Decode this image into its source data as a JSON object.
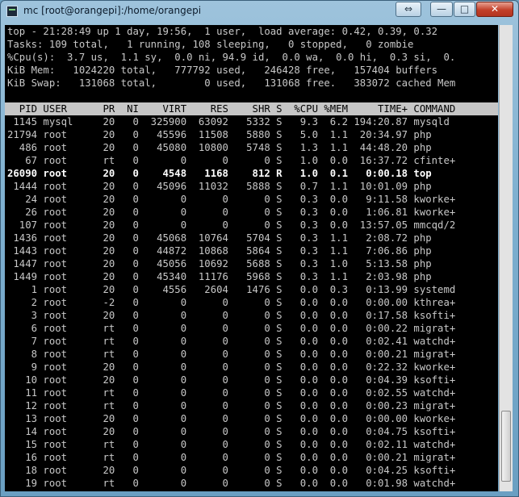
{
  "window": {
    "title": "mc [root@orangepi]:/home/orangepi",
    "buttons": {
      "resize": "⇔",
      "minimize": "—",
      "maximize": "□",
      "close": "✕"
    }
  },
  "summary": [
    "top - 21:28:49 up 1 day, 19:56,  1 user,  load average: 0.42, 0.39, 0.32",
    "Tasks: 109 total,   1 running, 108 sleeping,   0 stopped,   0 zombie",
    "%Cpu(s):  3.7 us,  1.1 sy,  0.0 ni, 94.9 id,  0.0 wa,  0.0 hi,  0.3 si,  0.",
    "KiB Mem:   1024220 total,   777792 used,   246428 free,   157404 buffers",
    "KiB Swap:   131068 total,        0 used,   131068 free.   383072 cached Mem"
  ],
  "table_header": "  PID USER      PR  NI    VIRT    RES    SHR S  %CPU %MEM     TIME+ COMMAND",
  "rows": [
    " 1145 mysql     20   0  325900  63092   5332 S   9.3  6.2 194:20.87 mysqld",
    "21794 root      20   0   45596  11508   5880 S   5.0  1.1  20:34.97 php",
    "  486 root      20   0   45080  10800   5748 S   1.3  1.1  44:48.20 php",
    "   67 root      rt   0       0      0      0 S   1.0  0.0  16:37.72 cfinte+",
    "26090 root      20   0    4548   1168    812 R   1.0  0.1   0:00.18 top",
    " 1444 root      20   0   45096  11032   5888 S   0.7  1.1  10:01.09 php",
    "   24 root      20   0       0      0      0 S   0.3  0.0   9:11.58 kworke+",
    "   26 root      20   0       0      0      0 S   0.3  0.0   1:06.81 kworke+",
    "  107 root      20   0       0      0      0 S   0.3  0.0  13:57.05 mmcqd/2",
    " 1436 root      20   0   45068  10764   5704 S   0.3  1.1   2:08.72 php",
    " 1443 root      20   0   44872  10868   5864 S   0.3  1.1   7:06.86 php",
    " 1447 root      20   0   45056  10692   5688 S   0.3  1.0   5:13.58 php",
    " 1449 root      20   0   45340  11176   5968 S   0.3  1.1   2:03.98 php",
    "    1 root      20   0    4556   2604   1476 S   0.0  0.3   0:13.99 systemd",
    "    2 root      -2   0       0      0      0 S   0.0  0.0   0:00.00 kthrea+",
    "    3 root      20   0       0      0      0 S   0.0  0.0   0:17.58 ksofti+",
    "    6 root      rt   0       0      0      0 S   0.0  0.0   0:00.22 migrat+",
    "    7 root      rt   0       0      0      0 S   0.0  0.0   0:02.41 watchd+",
    "    8 root      rt   0       0      0      0 S   0.0  0.0   0:00.21 migrat+",
    "    9 root      20   0       0      0      0 S   0.0  0.0   0:22.32 kworke+",
    "   10 root      20   0       0      0      0 S   0.0  0.0   0:04.39 ksofti+",
    "   11 root      rt   0       0      0      0 S   0.0  0.0   0:02.55 watchd+",
    "   12 root      rt   0       0      0      0 S   0.0  0.0   0:00.23 migrat+",
    "   13 root      20   0       0      0      0 S   0.0  0.0   0:00.00 kworke+",
    "   14 root      20   0       0      0      0 S   0.0  0.0   0:04.75 ksofti+",
    "   15 root      rt   0       0      0      0 S   0.0  0.0   0:02.11 watchd+",
    "   16 root      rt   0       0      0      0 S   0.0  0.0   0:00.21 migrat+",
    "   18 root      20   0       0      0      0 S   0.0  0.0   0:04.25 ksofti+",
    "   19 root      rt   0       0      0      0 S   0.0  0.0   0:01.98 watchd+"
  ],
  "highlight_row_index": 4
}
